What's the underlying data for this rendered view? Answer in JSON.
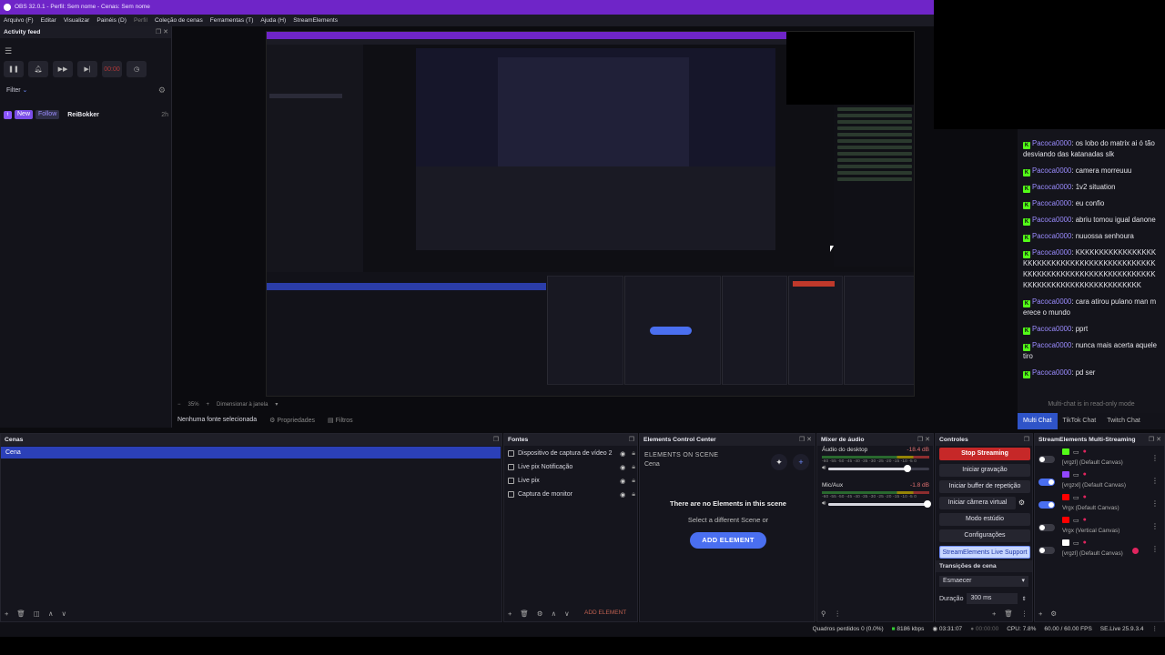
{
  "window": {
    "title": "OBS 32.0.1 - Perfil: Sem nome - Cenas: Sem nome"
  },
  "menu": {
    "items": [
      "Arquivo (F)",
      "Editar",
      "Visualizar",
      "Painéis (D)",
      "Perfil",
      "Coleção de cenas",
      "Ferramentas (T)",
      "Ajuda (H)",
      "StreamElements"
    ],
    "disabled_index": 4
  },
  "activity_feed": {
    "title": "Activity feed",
    "controls": [
      "pause",
      "bell",
      "skip",
      "next",
      "timer",
      "clock"
    ],
    "timer_value": "00:00",
    "filter_label": "Filter",
    "events": [
      {
        "platform": "twitch",
        "badge": "New",
        "type": "Follow",
        "user": "ReiBokker",
        "time": "2h"
      }
    ]
  },
  "preview_toolbar": {
    "zoom": "35%",
    "resize": "Dimensionar à janela",
    "no_source": "Nenhuma fonte selecionada",
    "properties": "Propriedades",
    "filters": "Filtros"
  },
  "chat": {
    "messages": [
      {
        "user": "Pacoca0000",
        "text": "os lobo do matrix ai ó tão desviando das katanadas slk"
      },
      {
        "user": "Pacoca0000",
        "text": "camera morreuuu"
      },
      {
        "user": "Pacoca0000",
        "text": "1v2 situation"
      },
      {
        "user": "Pacoca0000",
        "text": "eu confio"
      },
      {
        "user": "Pacoca0000",
        "text": "abriu tomou igual danone"
      },
      {
        "user": "Pacoca0000",
        "text": "nuuossa senhoura"
      },
      {
        "user": "Pacoca0000",
        "text": "KKKKKKKKKKKKKKKKKKKKKKKKKKKKKKKKKKKKKKKKKKKKKKKKKKKKKKKKKKKKKKKKKKKKKKKKKKKKKKKKKKKKKKKKKKKKKKKKKK"
      },
      {
        "user": "Pacoca0000",
        "text": "cara atirou pulano man merece o mundo"
      },
      {
        "user": "Pacoca0000",
        "text": "pprt"
      },
      {
        "user": "Pacoca0000",
        "text": "nunca mais acerta aquele tiro"
      },
      {
        "user": "Pacoca0000",
        "text": "pd ser"
      }
    ],
    "read_only": "Multi-chat is in read-only mode",
    "tabs": [
      "Multi Chat",
      "TikTok Chat",
      "Twitch Chat"
    ],
    "active_tab": 0
  },
  "scenes": {
    "title": "Cenas",
    "items": [
      "Cena"
    ]
  },
  "sources": {
    "title": "Fontes",
    "items": [
      "Dispositivo de captura de vídeo 2",
      "Live pix Notificação",
      "Live pix",
      "Captura de monitor"
    ],
    "footer_add": "ADD ELEMENT"
  },
  "ecc": {
    "title": "Elements Control Center",
    "label": "ELEMENTS ON SCENE",
    "scene": "Cena",
    "empty": "There are no Elements in this scene",
    "select": "Select a different Scene or",
    "add": "ADD ELEMENT"
  },
  "mixer": {
    "title": "Mixer de áudio",
    "tracks": [
      {
        "name": "Áudio do desktop",
        "db": "-18.4 dB",
        "volume": 0.78
      },
      {
        "name": "Mic/Aux",
        "db": "-1.8 dB",
        "volume": 0.98
      }
    ],
    "ticks": "-60 -55 -50 -45 -40 -35 -30 -25 -20 -15 -10 -5 0"
  },
  "controls": {
    "title": "Controles",
    "buttons": [
      "Stop Streaming",
      "Iniciar gravação",
      "Iniciar buffer de repetição",
      "Iniciar câmera virtual",
      "Modo estúdio",
      "Configurações",
      "StreamElements Live Support"
    ]
  },
  "transitions": {
    "title": "Transições de cena",
    "selected": "Esmaecer",
    "duration_label": "Duração",
    "duration": "300 ms"
  },
  "multistream": {
    "title": "StreamElements Multi-Streaming",
    "rows": [
      {
        "on": false,
        "label": "[vrgzl] (Default Canvas)",
        "platform": "kick",
        "color": "#53fc18",
        "live": false
      },
      {
        "on": true,
        "label": "[vrgzxl] (Default Canvas)",
        "platform": "twitch",
        "color": "#9146ff",
        "live": false
      },
      {
        "on": true,
        "label": "Vrgx (Default Canvas)",
        "platform": "youtube",
        "color": "#ff0000",
        "live": false
      },
      {
        "on": false,
        "label": "Vrgx (Vertical Canvas)",
        "platform": "youtube",
        "color": "#ff0000",
        "live": false
      },
      {
        "on": false,
        "label": "[vrgzl] (Default Canvas)",
        "platform": "tiktok",
        "color": "#ffffff",
        "live": true
      }
    ]
  },
  "status": {
    "frames": "Quadros perdidos 0 (0.0%)",
    "bitrate": "8186 kbps",
    "live_time": "03:31:07",
    "rec_time": "00:00:00",
    "cpu": "CPU: 7.8%",
    "fps": "60.00 / 60.00 FPS",
    "version": "SE.Live 25.9.3.4"
  }
}
